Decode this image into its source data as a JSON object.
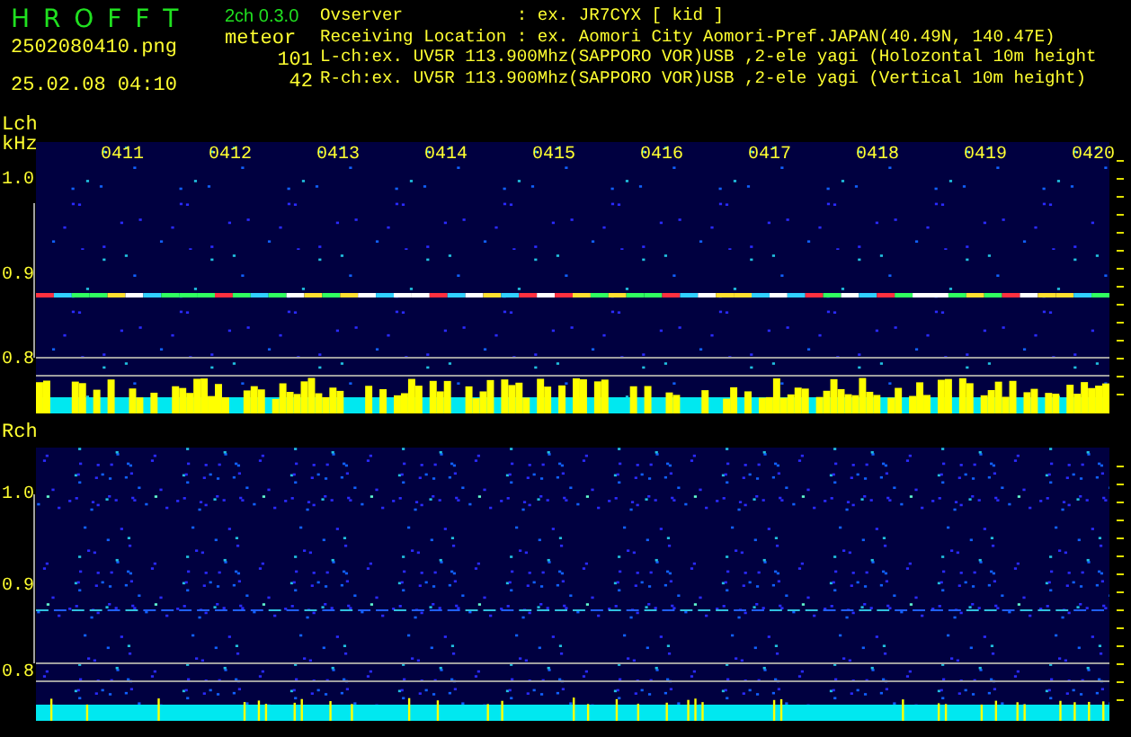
{
  "header": {
    "app_name": "H R O F F T",
    "version": "2ch 0.3.0",
    "file_name": "2502080410.png",
    "datetime": "25.02.08 04:10",
    "meteor_label": "meteor",
    "meteor_counts": [
      "101",
      "42"
    ]
  },
  "info_lines": [
    "Ovserver           : ex. JR7CYX [ kid ]",
    "Receiving Location : ex. Aomori City Aomori-Pref.JAPAN(40.49N, 140.47E)",
    "L-ch:ex. UV5R 113.900Mhz(SAPPORO VOR)USB ,2-ele yagi (Holozontal 10m height",
    "R-ch:ex. UV5R 113.900Mhz(SAPPORO VOR)USB ,2-ele yagi (Vertical 10m height)"
  ],
  "channels": [
    {
      "label": "Lch",
      "unit": "kHz",
      "time_labels": [
        "0411",
        "0412",
        "0413",
        "0414",
        "0415",
        "0416",
        "0417",
        "0418",
        "0419",
        "0420"
      ],
      "freq_ticks": [
        "1.0",
        "0.9",
        "0.8"
      ]
    },
    {
      "label": "Rch",
      "freq_ticks": [
        "1.0",
        "0.9",
        "0.8"
      ]
    }
  ]
}
